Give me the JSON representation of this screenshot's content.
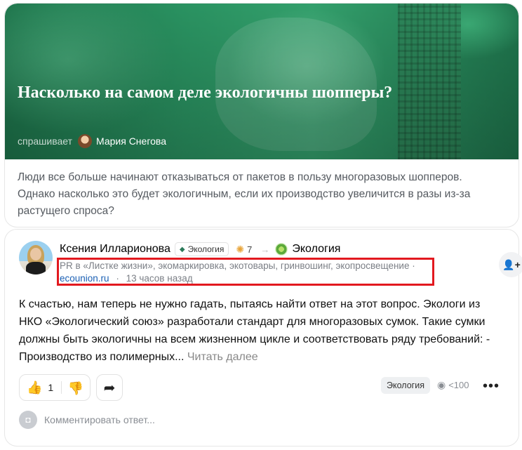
{
  "question": {
    "title": "Насколько на самом деле экологичны шопперы?",
    "asks_label": "спрашивает",
    "asker_name": "Мария Снегова",
    "text": "Люди все больше начинают отказываться от пакетов в пользу многоразовых шопперов. Однако насколько это будет экологичным, если их производство увеличится в разы из-за растущего спроса?"
  },
  "answer": {
    "author_name": "Ксения Илларионова",
    "badge_label": "Экология",
    "rating": "7",
    "topic_name": "Экология",
    "meta_line": "PR в «Листке жизни», экомаркировка, экотовары, гринвошинг, экопросвещение ·",
    "site_link": "ecounion.ru",
    "separator": "·",
    "time_ago": "13 часов назад",
    "body": "К счастью, нам теперь не нужно гадать, пытаясь найти ответ на этот вопрос. Экологи из НКО «Экологический союз» разработали стандарт для многоразовых сумок. Такие сумки должны быть экологичны на всем жизненном цикле и соответствовать ряду требований: - Производство из полимерных...",
    "read_more": "Читать далее",
    "likes": "1",
    "tag": "Экология",
    "views": "<100",
    "comment_placeholder": "Комментировать ответ..."
  },
  "icons": {
    "badge": "diamond-icon",
    "rating": "sun-icon",
    "like": "thumb-up-icon",
    "dislike": "thumb-down-icon",
    "share": "share-arrow-icon",
    "views": "eye-icon",
    "more": "more-dots-icon",
    "follow": "add-user-icon",
    "comment": "camera-icon"
  },
  "colors": {
    "highlight_box": "#e2191f",
    "link": "#1a5fb4",
    "hero_green": "#2c9a66"
  }
}
